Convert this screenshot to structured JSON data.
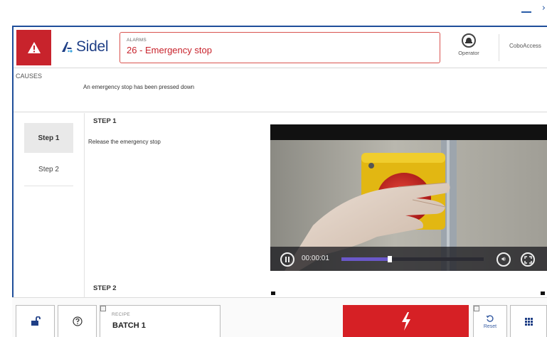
{
  "window": {
    "minimize_icon": "minimize-icon",
    "close_glyph": "›"
  },
  "header": {
    "alarm_icon": "warning-triangle-icon",
    "logo_text": "Sidel",
    "alarm_label": "ALARMS",
    "alarm_text": "26 - Emergency stop",
    "operator_label": "Operator",
    "user_label": "CoboAccess"
  },
  "causes": {
    "title": "CAUSES",
    "text": "An emergency stop has been pressed down"
  },
  "steps": {
    "nav": [
      {
        "label": "Step 1",
        "active": true
      },
      {
        "label": "Step 2",
        "active": false
      }
    ],
    "items": [
      {
        "title": "STEP 1",
        "description": "Release the emergency stop"
      },
      {
        "title": "STEP 2"
      }
    ]
  },
  "video": {
    "time": "00:00:01",
    "progress": 0.34,
    "played_color": "#6a58c9"
  },
  "bottombar": {
    "recipe_label": "RECIPE",
    "recipe_value": "BATCH 1",
    "reset_label": "Reset",
    "emergency_color": "#d62025"
  },
  "colors": {
    "alarm_red": "#c8232c",
    "brand_blue": "#1f3f86"
  }
}
